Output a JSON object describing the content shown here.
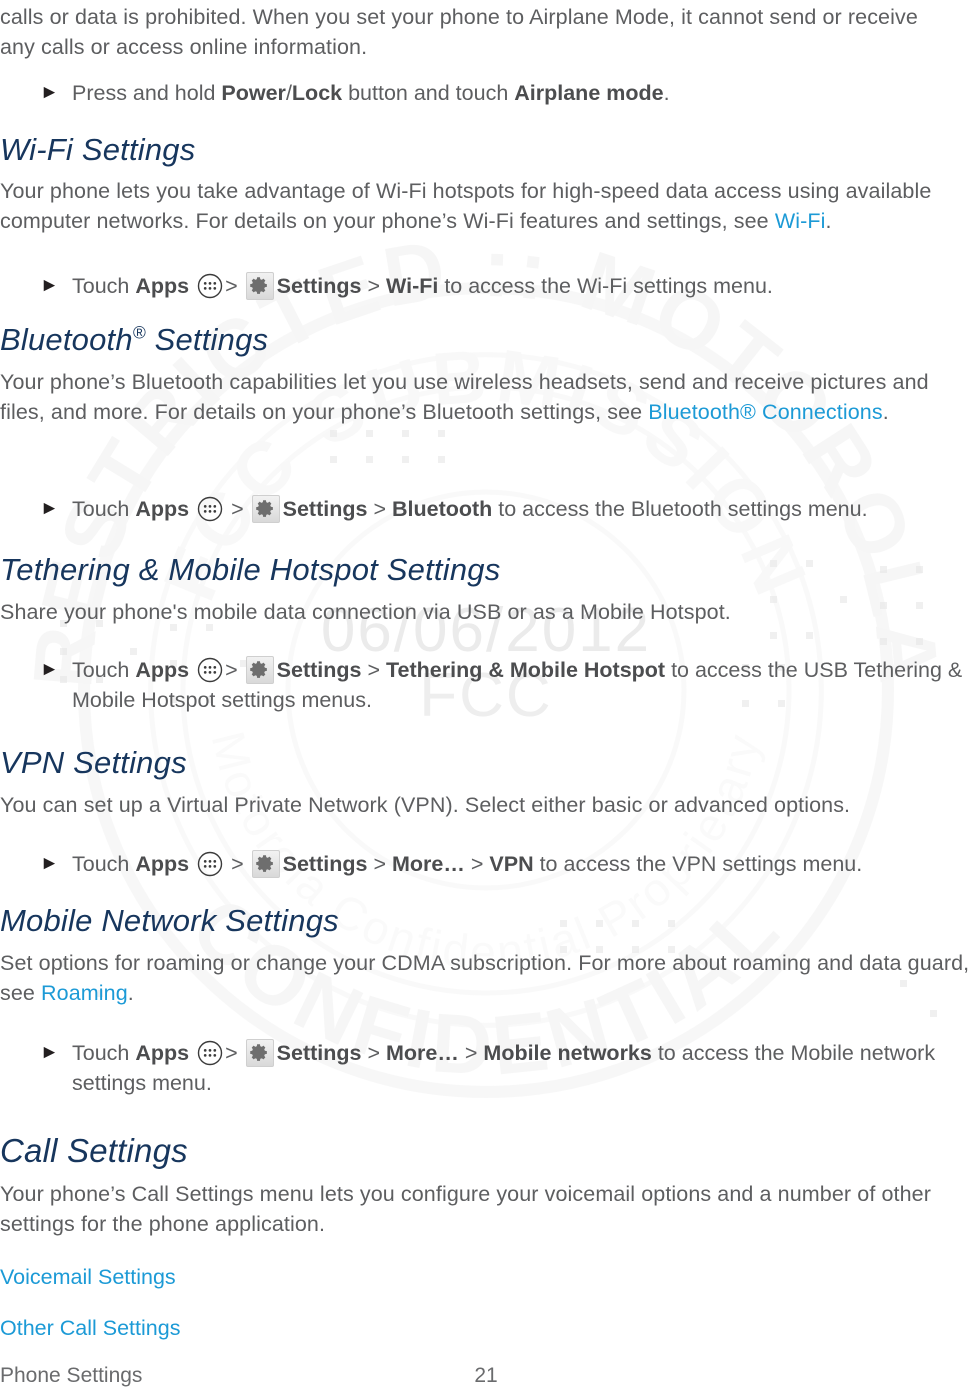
{
  "document": {
    "type": "user-guide-page",
    "page_number": "21",
    "footer_section": "Phone Settings"
  },
  "watermark": {
    "seal_text": "RESTRICTED :: MOTOROLA CONFIDENTIAL",
    "seal_inner_text": "FCC SUBMISSION",
    "date": "06/06/2012",
    "label": "FCC"
  },
  "colors": {
    "heading": "#17365d",
    "body": "#5d5e60",
    "link": "#1c9ad6",
    "bold": "#4c4d4f"
  },
  "intro": {
    "line1": "calls or data is prohibited. When you set your phone to Airplane Mode, it cannot send or receive",
    "line2": "any calls or access online information.",
    "bullet": {
      "marker": "►",
      "pre": "Press and hold ",
      "bold1": "Power",
      "mid1": "/",
      "bold2": "Lock",
      "mid2": " button and touch ",
      "bold3": "Airplane mode",
      "post": "."
    }
  },
  "sections": [
    {
      "id": "wifi",
      "heading": "Wi-Fi Settings",
      "heading_sup": "",
      "body_pre": "Your phone lets you take advantage of Wi-Fi hotspots for high-speed data access using available computer networks. For details on your phone’s Wi-Fi features and settings, see ",
      "body_link": "Wi-Fi",
      "body_post": ".",
      "bullet": {
        "marker": "►",
        "touch": "Touch ",
        "apps": "Apps",
        "apps_icon": "apps-grid-icon",
        "sep1": ">",
        "gear_icon": "settings-gear-icon",
        "settings": "Settings",
        "sep2": ">",
        "target": "Wi-Fi",
        "tail": " to access the Wi-Fi settings menu."
      }
    },
    {
      "id": "bluetooth",
      "heading": "Bluetooth",
      "heading_sup": "®",
      "heading_tail": " Settings",
      "body_pre": "Your phone’s Bluetooth capabilities let you use wireless headsets, send and receive pictures and files, and more. For details on your phone’s Bluetooth settings, see ",
      "body_link": "Bluetooth® Connections",
      "body_post": ".",
      "bullet": {
        "marker": "►",
        "touch": "Touch ",
        "apps": "Apps",
        "apps_icon": "apps-grid-icon",
        "sep1": ">",
        "gear_icon": "settings-gear-icon",
        "settings": "Settings",
        "sep2": ">",
        "target": "Bluetooth",
        "tail": " to access the Bluetooth settings menu."
      }
    },
    {
      "id": "tethering",
      "heading": "Tethering & Mobile Hotspot Settings",
      "body_pre": "Share your phone's mobile data connection via USB or as a Mobile Hotspot.",
      "body_link": "",
      "body_post": "",
      "bullet": {
        "marker": "►",
        "touch": "Touch ",
        "apps": "Apps",
        "apps_icon": "apps-grid-icon",
        "sep1": ">",
        "gear_icon": "settings-gear-icon",
        "settings": "Settings",
        "sep2": ">",
        "target": "Tethering & Mobile Hotspot",
        "tail": " to access the USB Tethering & Mobile Hotspot settings menus."
      }
    },
    {
      "id": "vpn",
      "heading": "VPN Settings",
      "body_pre": "You can set up a Virtual Private Network (VPN). Select either basic or advanced options.",
      "body_link": "",
      "body_post": "",
      "bullet": {
        "marker": "►",
        "touch": "Touch ",
        "apps": "Apps",
        "apps_icon": "apps-grid-icon",
        "sep1": ">",
        "gear_icon": "settings-gear-icon",
        "settings": "Settings",
        "sep2": ">",
        "more": "More…",
        "sep3": ">",
        "target": "VPN",
        "tail": " to access the VPN settings menu."
      }
    },
    {
      "id": "mobile-network",
      "heading": "Mobile Network Settings",
      "body_pre": "Set options for roaming or change your CDMA subscription. For more about roaming and data guard, see ",
      "body_link": "Roaming",
      "body_post": ".",
      "bullet": {
        "marker": "►",
        "touch": "Touch ",
        "apps": "Apps",
        "apps_icon": "apps-grid-icon",
        "sep1": ">",
        "gear_icon": "settings-gear-icon",
        "settings": "Settings",
        "sep2": ">",
        "more": "More…",
        "sep3": ">",
        "target": "Mobile networks",
        "tail": " to access the Mobile network settings menu."
      }
    },
    {
      "id": "call",
      "heading": "Call Settings",
      "body_pre": "Your phone’s Call Settings menu lets you configure your voicemail options and a number of other settings for the phone application.",
      "body_link": "",
      "body_post": "",
      "links": [
        "Voicemail Settings",
        "Other Call Settings"
      ]
    }
  ]
}
